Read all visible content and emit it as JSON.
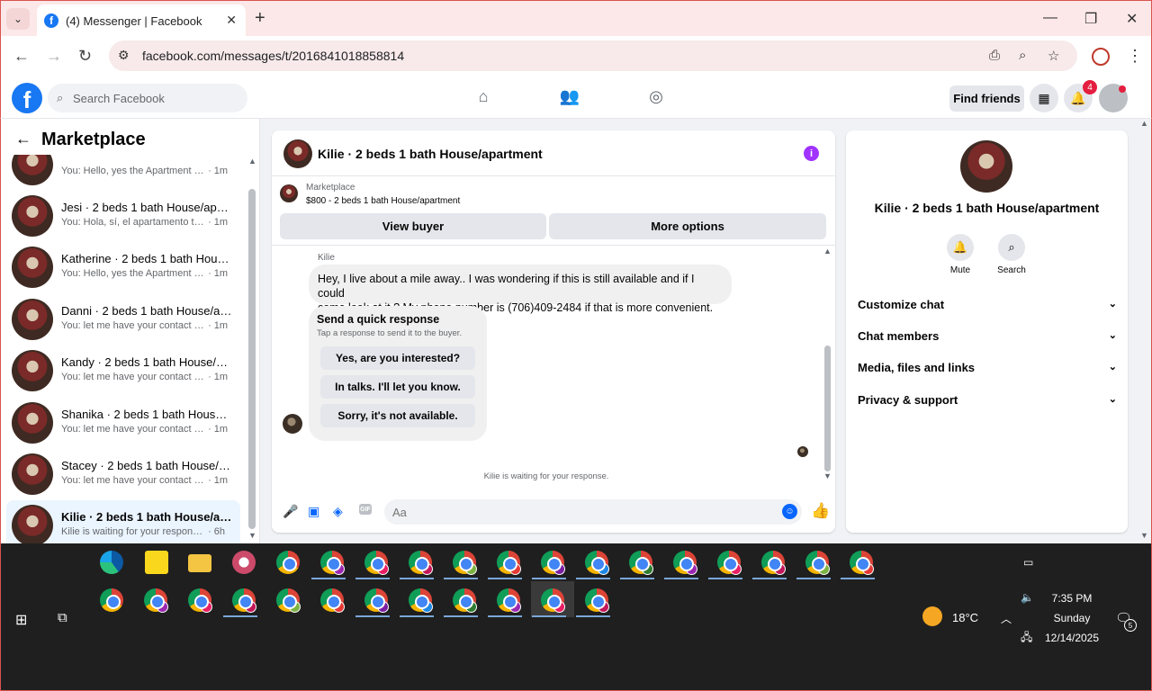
{
  "browser": {
    "tab_title": "(4) Messenger | Facebook",
    "url": "facebook.com/messages/t/2016841018858814",
    "accent": "#d9534f"
  },
  "fb_header": {
    "search_placeholder": "Search Facebook",
    "find_friends": "Find friends",
    "notification_count": "4"
  },
  "left": {
    "title": "Marketplace",
    "conversations": [
      {
        "name": "",
        "snippet": "You: Hello, yes the Apartment is st...",
        "time": "· 1m",
        "active": false
      },
      {
        "name": "Jesi · 2 beds 1 bath House/apart...",
        "snippet": "You: Hola, sí, el apartamento toda...",
        "time": "· 1m",
        "active": false
      },
      {
        "name": "Katherine · 2 beds 1 bath House...",
        "snippet": "You: Hello, yes the Apartment is st...",
        "time": "· 1m",
        "active": false
      },
      {
        "name": "Danni · 2 beds 1 bath House/ap...",
        "snippet": "You: let me have your contact nu...",
        "time": "· 1m",
        "active": false
      },
      {
        "name": "Kandy · 2 beds 1 bath House/ap...",
        "snippet": "You: let me have your contact nu...",
        "time": "· 1m",
        "active": false
      },
      {
        "name": "Shanika · 2 beds 1 bath House/a...",
        "snippet": "You: let me have your contact nu...",
        "time": "· 1m",
        "active": false
      },
      {
        "name": "Stacey · 2 beds 1 bath House/ap...",
        "snippet": "You: let me have your contact nu...",
        "time": "· 1m",
        "active": false
      },
      {
        "name": "Kilie · 2 beds 1 bath House/apar...",
        "snippet": "Kilie is waiting for your response.",
        "time": "· 6h",
        "active": true
      }
    ]
  },
  "chat": {
    "title": "Kilie · 2 beds 1 bath House/apartment",
    "marketplace_label": "Marketplace",
    "listing": "$800 - 2 beds 1 bath House/apartment",
    "view_buyer": "View buyer",
    "more_options": "More options",
    "sender": "Kilie",
    "message_line1": "Hey, I live about a mile away.. I was wondering if this is still available and if I could",
    "message_line2": "come look at it ? My phone number is (706)409-2484 if that is more convenient.",
    "quick_title": "Send a quick response",
    "quick_sub": "Tap a response to send it to the buyer.",
    "quick_options": [
      "Yes, are you interested?",
      "In talks. I'll let you know.",
      "Sorry, it's not available."
    ],
    "waiting": "Kilie is waiting for your response.",
    "input_placeholder": "Aa",
    "gif_label": "GIF"
  },
  "right": {
    "name": "Kilie · 2 beds 1 bath House/apartment",
    "actions": [
      {
        "label": "Mute",
        "icon": "bell-icon"
      },
      {
        "label": "Search",
        "icon": "search-icon"
      }
    ],
    "sections": [
      "Customize chat",
      "Chat members",
      "Media, files and links",
      "Privacy & support"
    ]
  },
  "taskbar": {
    "temperature": "18°C",
    "time": "7:35 PM",
    "day": "Sunday",
    "date": "12/14/2025",
    "notification_count": "5"
  }
}
